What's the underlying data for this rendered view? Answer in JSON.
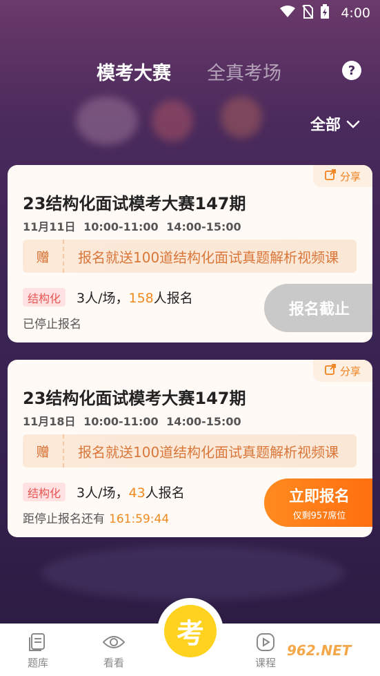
{
  "status_bar": {
    "time": "4:00"
  },
  "header": {
    "tabs": [
      {
        "label": "模考大赛"
      },
      {
        "label": "全真考场"
      }
    ],
    "help": "?"
  },
  "filter": {
    "label": "全部"
  },
  "cards": [
    {
      "share": "分享",
      "title": "23结构化面试模考大赛147期",
      "time": "11月11日  10:00-11:00  14:00-15:00",
      "gift_tag": "赠",
      "gift_text": "报名就送100道结构化面试真题解析视频课",
      "tag": "结构化",
      "per_session": "3人/场，",
      "count": "158",
      "count_suffix": "人报名",
      "status": "已停止报名",
      "button": "报名截止"
    },
    {
      "share": "分享",
      "title": "23结构化面试模考大赛147期",
      "time": "11月18日  10:00-11:00  14:00-15:00",
      "gift_tag": "赠",
      "gift_text": "报名就送100道结构化面试真题解析视频课",
      "tag": "结构化",
      "per_session": "3人/场，",
      "count": "43",
      "count_suffix": "人报名",
      "status": "距停止报名还有",
      "countdown": "161:59:44",
      "button": "立即报名",
      "button_sub": "仅剩957席位"
    }
  ],
  "bottom_nav": {
    "items": [
      {
        "label": "题库"
      },
      {
        "label": "看看"
      },
      {
        "label": "考"
      },
      {
        "label": "课程"
      }
    ]
  },
  "watermark": "962.NET",
  "colors": {
    "accent": "#ff7a18",
    "tag_red": "#e85555",
    "closed_gray": "#c9c9c9"
  }
}
